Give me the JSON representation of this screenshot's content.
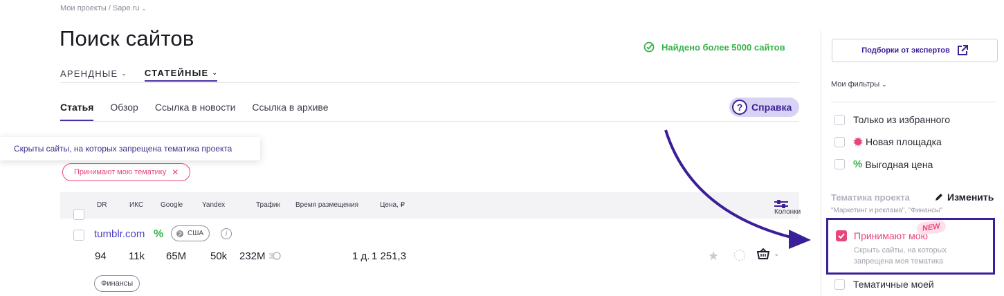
{
  "breadcrumb": "Мои проекты / Sape.ru",
  "page_title": "Поиск сайтов",
  "found_text": "Найдено более 5000 сайтов",
  "type_tabs": [
    {
      "label": "АРЕНДНЫЕ",
      "active": false
    },
    {
      "label": "СТАТЕЙНЫЕ",
      "active": true
    }
  ],
  "sub_tabs": [
    {
      "label": "Статья",
      "active": true
    },
    {
      "label": "Обзор",
      "active": false
    },
    {
      "label": "Ссылка в новости",
      "active": false
    },
    {
      "label": "Ссылка в архиве",
      "active": false
    }
  ],
  "help_label": "Справка",
  "hint_text": "Скрыты сайты, на которых запрещена тематика проекта",
  "chip_label": "Принимают мою тематику",
  "table": {
    "columns": [
      "DR",
      "ИКС",
      "Google",
      "Yandex",
      "Трафик",
      "Время размещения",
      "Цена, ₽"
    ],
    "columns_button": "Колонки",
    "row": {
      "site": "tumblr.com",
      "country": "США",
      "dr": "94",
      "iks": "11k",
      "google": "65M",
      "yandex": "50k",
      "traffic": "232M",
      "time": "1 д.",
      "price": "1 251,3",
      "tag": "Финансы"
    }
  },
  "sidebar": {
    "experts_label": "Подборки от экспертов",
    "my_filters_label": "Мои фильтры",
    "filters": [
      {
        "label": "Только из избранного"
      },
      {
        "label": "Новая площадка"
      },
      {
        "label": "Выгодная цена"
      }
    ],
    "topic_title": "Тематика проекта",
    "topic_edit": "Изменить",
    "topic_values": "\"Маркетинг и реклама\", \"Финансы\"",
    "accept_label": "Принимают мою",
    "new_badge": "NEW",
    "accept_desc": "Скрыть сайты, на которых запрещена моя тематика",
    "thematic_label": "Тематичные моей"
  },
  "colors": {
    "accent": "#3b1f98",
    "pink": "#e6457d",
    "green": "#36b24a",
    "link": "#4b3fc8"
  }
}
